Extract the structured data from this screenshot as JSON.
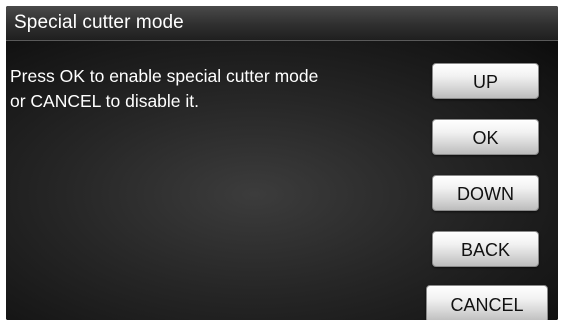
{
  "window": {
    "title": "Special cutter mode"
  },
  "message": {
    "line1": "Press OK to enable special cutter mode",
    "line2": "or CANCEL to disable it."
  },
  "buttons": {
    "up": "UP",
    "ok": "OK",
    "down": "DOWN",
    "back": "BACK",
    "cancel": "CANCEL"
  },
  "colors": {
    "background": "#0a0a0a",
    "title_bar": "#2f2f2f",
    "text": "#ffffff",
    "button_face": "#e6e6e6",
    "button_text": "#111111"
  }
}
